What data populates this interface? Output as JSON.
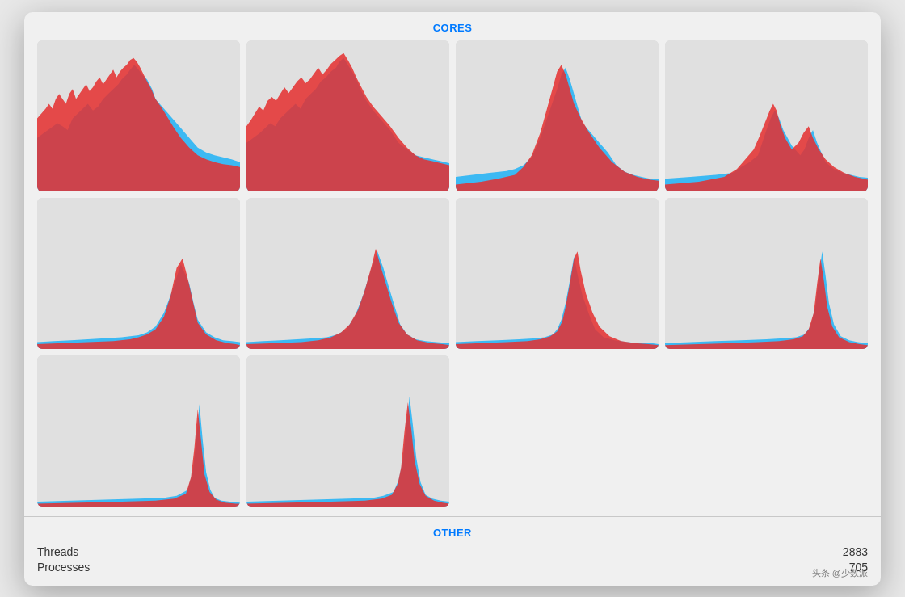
{
  "header": {
    "cores_label": "CORES",
    "other_label": "OTHER"
  },
  "stats": {
    "threads_label": "Threads",
    "threads_value": "2883",
    "processes_label": "Processes",
    "processes_value": "705"
  },
  "watermark": "头条 @少数派",
  "colors": {
    "blue": "#2bb5f5",
    "red": "#e53030",
    "bg": "#e0e0e0"
  }
}
